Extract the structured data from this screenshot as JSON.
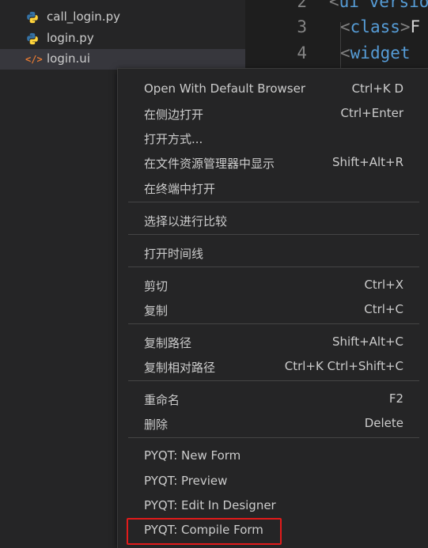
{
  "explorer": {
    "files": [
      {
        "name": "call_login.py",
        "icon": "python-icon"
      },
      {
        "name": "login.py",
        "icon": "python-icon"
      },
      {
        "name": "login.ui",
        "icon": "xml-icon",
        "selected": true
      }
    ]
  },
  "editor": {
    "lines": [
      {
        "number": "2",
        "open": "<",
        "tag": "ui version",
        "rest": ""
      },
      {
        "number": "3",
        "open": "<",
        "tag": "class",
        "close": ">",
        "rest": "F"
      },
      {
        "number": "4",
        "open": "<",
        "tag": "widget",
        "rest": ""
      }
    ]
  },
  "context_menu": {
    "items": [
      {
        "label": "Open With Default Browser",
        "shortcut": "Ctrl+K D"
      },
      {
        "label": "在侧边打开",
        "shortcut": "Ctrl+Enter"
      },
      {
        "label": "打开方式...",
        "shortcut": ""
      },
      {
        "label": "在文件资源管理器中显示",
        "shortcut": "Shift+Alt+R"
      },
      {
        "label": "在终端中打开",
        "shortcut": ""
      },
      {
        "label": "选择以进行比较",
        "shortcut": ""
      },
      {
        "label": "打开时间线",
        "shortcut": ""
      },
      {
        "label": "剪切",
        "shortcut": "Ctrl+X"
      },
      {
        "label": "复制",
        "shortcut": "Ctrl+C"
      },
      {
        "label": "复制路径",
        "shortcut": "Shift+Alt+C"
      },
      {
        "label": "复制相对路径",
        "shortcut": "Ctrl+K Ctrl+Shift+C"
      },
      {
        "label": "重命名",
        "shortcut": "F2"
      },
      {
        "label": "删除",
        "shortcut": "Delete"
      },
      {
        "label": "PYQT: New Form",
        "shortcut": ""
      },
      {
        "label": "PYQT: Preview",
        "shortcut": ""
      },
      {
        "label": "PYQT: Edit In Designer",
        "shortcut": ""
      },
      {
        "label": "PYQT: Compile Form",
        "shortcut": ""
      }
    ]
  },
  "colors": {
    "highlight_box": "#e21b1b",
    "python_blue": "#3572A5",
    "python_yellow": "#FFD43B",
    "xml_orange": "#e37933",
    "tag_blue": "#569cd6"
  }
}
